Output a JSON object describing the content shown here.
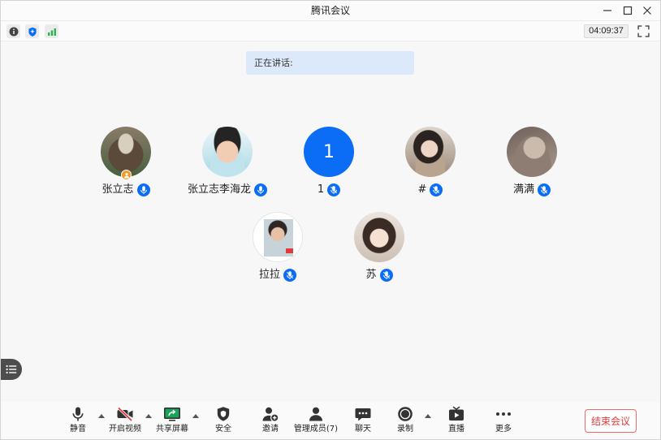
{
  "window": {
    "title": "腾讯会议",
    "controls": {
      "minimize_icon": "minimize-icon",
      "maximize_icon": "maximize-icon",
      "close_icon": "close-icon"
    }
  },
  "status_bar": {
    "timer": "04:09:37",
    "icons": [
      "info-icon",
      "shield-icon",
      "signal-icon",
      "fullscreen-icon"
    ]
  },
  "speaking": {
    "label": "正在讲话:"
  },
  "participants": [
    {
      "name": "张立志",
      "mic_icon": "mic-icon",
      "badge_icon": "host-icon"
    },
    {
      "name": "张立志李海龙",
      "mic_icon": "mic-icon"
    },
    {
      "name": "1",
      "avatar_text": "1",
      "mic_icon": "mic-muted-icon"
    },
    {
      "name": "#",
      "mic_icon": "mic-muted-icon"
    },
    {
      "name": "满满",
      "mic_icon": "mic-muted-icon"
    },
    {
      "name": "拉拉",
      "mic_icon": "mic-muted-icon"
    },
    {
      "name": "苏",
      "mic_icon": "mic-muted-icon"
    }
  ],
  "side_panel": {
    "icon": "list-icon"
  },
  "toolbar": {
    "mute": {
      "label": "静音",
      "icon": "mic-icon"
    },
    "video": {
      "label": "开启视频",
      "icon": "video-off-icon"
    },
    "share": {
      "label": "共享屏幕",
      "icon": "share-screen-icon"
    },
    "security": {
      "label": "安全",
      "icon": "shield-icon"
    },
    "invite": {
      "label": "邀请",
      "icon": "invite-user-icon"
    },
    "members": {
      "label": "管理成员(7)",
      "icon": "members-icon"
    },
    "chat": {
      "label": "聊天",
      "icon": "chat-icon"
    },
    "record": {
      "label": "录制",
      "icon": "record-icon"
    },
    "live": {
      "label": "直播",
      "icon": "live-icon"
    },
    "more": {
      "label": "更多",
      "icon": "more-icon"
    },
    "end_meeting": {
      "label": "结束会议"
    }
  },
  "colors": {
    "accent_blue": "#0b6df6",
    "speaking_bg": "#dce9fb",
    "end_red": "#e23c3c",
    "share_green": "#1aa35a",
    "video_off_red": "#e5393b",
    "signal_green": "#2bb24c",
    "host_orange": "#f39a2b"
  }
}
